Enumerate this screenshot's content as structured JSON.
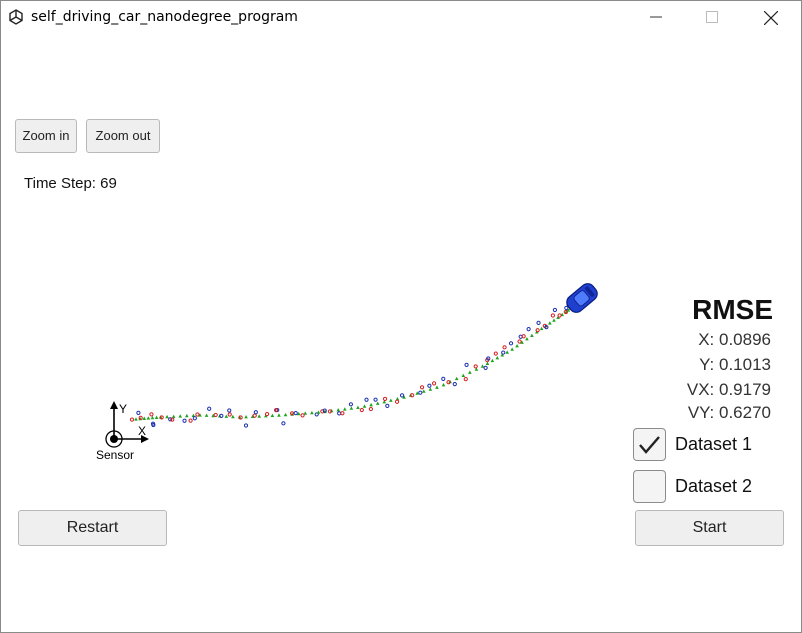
{
  "window": {
    "title": "self_driving_car_nanodegree_program",
    "icon": "unity-icon",
    "controls": [
      "minimize-icon",
      "maximize-icon",
      "close-icon"
    ]
  },
  "toolbar": {
    "zoom_in_label": "Zoom in",
    "zoom_out_label": "Zoom out"
  },
  "status": {
    "time_step_text": "Time Step: 69"
  },
  "scene": {
    "sensor_label": "Sensor",
    "axis_x_label": "X",
    "axis_y_label": "Y",
    "car_color": "#1f3fcf",
    "lidar_color": "#d42020",
    "radar_color": "#1a2fb0",
    "estimate_color": "#1fa31f"
  },
  "rmse": {
    "title": "RMSE",
    "x_text": "X: 0.0896",
    "y_text": "Y: 0.1013",
    "vx_text": "VX: 0.9179",
    "vy_text": "VY: 0.6270"
  },
  "datasets": {
    "dataset1_label": "Dataset 1",
    "dataset1_checked": true,
    "dataset2_label": "Dataset 2",
    "dataset2_checked": false
  },
  "actions": {
    "restart_label": "Restart",
    "start_label": "Start"
  }
}
